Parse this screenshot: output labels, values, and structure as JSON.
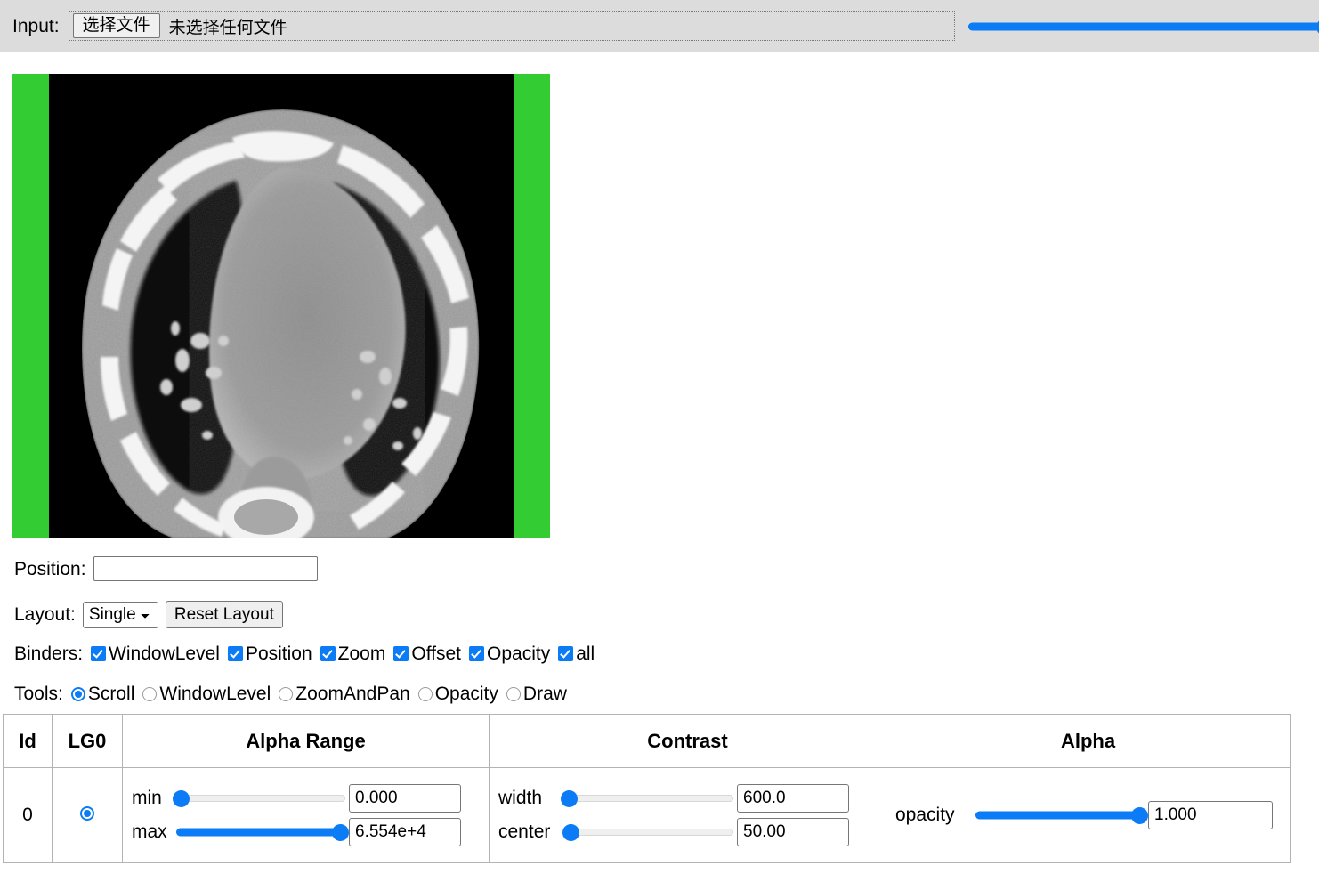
{
  "top_bar": {
    "label": "Input:",
    "choose_file_button": "选择文件",
    "file_status": "未选择任何文件",
    "slider": {
      "name": "input-slider",
      "value": 100,
      "min": 0,
      "max": 100
    }
  },
  "viewport": {
    "name": "ct-viewport",
    "background_color": "#33cc33",
    "image_background": "#000000",
    "modality": "CT chest axial slice"
  },
  "controls": {
    "position": {
      "label": "Position:",
      "value": "",
      "placeholder": ""
    },
    "layout": {
      "label": "Layout:",
      "selected": "Single",
      "options": [
        "Single"
      ],
      "reset_button": "Reset Layout"
    },
    "binders": {
      "label": "Binders:",
      "items": [
        {
          "label": "WindowLevel",
          "checked": true
        },
        {
          "label": "Position",
          "checked": true
        },
        {
          "label": "Zoom",
          "checked": true
        },
        {
          "label": "Offset",
          "checked": true
        },
        {
          "label": "Opacity",
          "checked": true
        },
        {
          "label": "all",
          "checked": true
        }
      ]
    },
    "tools": {
      "label": "Tools:",
      "items": [
        {
          "label": "Scroll",
          "selected": true
        },
        {
          "label": "WindowLevel",
          "selected": false
        },
        {
          "label": "ZoomAndPan",
          "selected": false
        },
        {
          "label": "Opacity",
          "selected": false
        },
        {
          "label": "Draw",
          "selected": false
        }
      ]
    }
  },
  "table": {
    "headers": [
      "Id",
      "LG0",
      "Alpha Range",
      "Contrast",
      "Alpha"
    ],
    "rows": [
      {
        "id": "0",
        "lg0_selected": true,
        "alpha_range": [
          {
            "label": "min",
            "value": "0.000",
            "percent": 0
          },
          {
            "label": "max",
            "value": "6.554e+4",
            "percent": 100
          }
        ],
        "contrast": [
          {
            "label": "width",
            "value": "600.0",
            "percent": 2
          },
          {
            "label": "center",
            "value": "50.00",
            "percent": 3
          }
        ],
        "alpha": [
          {
            "label": "opacity",
            "value": "1.000",
            "percent": 100
          }
        ]
      }
    ]
  },
  "colors": {
    "accent_blue": "#0b7cf5",
    "viewport_green": "#33cc33",
    "bar_gray": "#dcdcdc"
  }
}
